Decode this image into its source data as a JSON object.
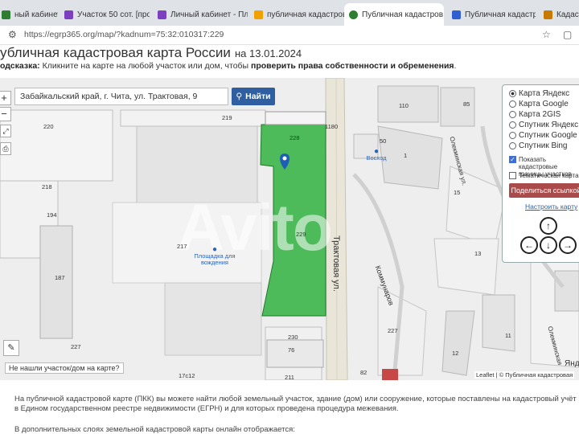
{
  "tabs": [
    {
      "label": "ный кабинет - Оц",
      "color": "#2e7d32"
    },
    {
      "label": "Участок 50 сот. [про",
      "color": "#7b3fbf"
    },
    {
      "label": "Личный кабинет - Пл",
      "color": "#7b3fbf"
    },
    {
      "label": "публичная кадастров",
      "color": "#f0a000"
    },
    {
      "label": "Публичная кадастров",
      "color": "#2e7d32"
    },
    {
      "label": "Публичная кадастров",
      "color": "#2f5fd0"
    },
    {
      "label": "Кадас",
      "color": "#c87a00"
    }
  ],
  "address": {
    "url": "https://egrp365.org/map/?kadnum=75:32:010317:229"
  },
  "heading": {
    "title": "убличная кадастровая карта России",
    "date": "на 13.01.2024"
  },
  "hint": {
    "prefix": "одсказка:",
    "text": " Кликните на карте на любой участок или дом, чтобы ",
    "bold": "проверить права собственности и обременения",
    "suffix": "."
  },
  "search": {
    "value": "Забайкальский край, г. Чита, ул. Трактовая, 9",
    "button": "Найти"
  },
  "map_labels": {
    "l220": "220",
    "l219": "219",
    "l1180": "1180",
    "l228": "228",
    "l110": "110",
    "l85": "85",
    "l50": "50",
    "l1": "1",
    "l218": "218",
    "l194": "194",
    "l187": "187",
    "l217": "217",
    "l227a": "227",
    "l230": "230",
    "l76": "76",
    "l82": "82",
    "l227b": "227",
    "l15": "15",
    "l13": "13",
    "l11": "11",
    "l17c12": "17с12",
    "l211": "211",
    "l229": "229",
    "l12": "12"
  },
  "pois": {
    "vosxod": "Восход",
    "ploshadka": "Площадка для вождения"
  },
  "roads": {
    "traktovaya": "Трактовая ул.",
    "kommunarov": "Коммунаров",
    "oleksinskaya": "Олекминская ул.",
    "oleksinskaya2": "Олекминская"
  },
  "panel": {
    "layers": [
      "Карта Яндекс",
      "Карта Google",
      "Карта 2GIS",
      "Спутник Яндекс",
      "Спутник Google",
      "Спутник Bing"
    ],
    "selected": 0,
    "show_borders": "Показать кадастровые границы участков",
    "thematic": "Тематическая карта",
    "share": "Поделиться ссылкой",
    "setup": "Настроить карту"
  },
  "controls": {
    "zoom_in": "+",
    "zoom_out": "−",
    "not_found": "Не нашли участок/дом на карте?"
  },
  "attribution": {
    "text": "Leaflet | © Публичная кадастровая",
    "extra": "Янд"
  },
  "info": {
    "p1": "На публичной кадастровой карте (ПКК) вы можете найти любой земельный участок, здание (дом) или сооружение, которые поставлены на кадастровый учёт в Едином государственном реестре недвижимости (ЕГРН) и для которых проведена процедура межевания.",
    "p2": "В дополнительных слоях земельной кадастровой карты онлайн отображается:"
  },
  "watermark": "Avito",
  "colors": {
    "parcel": "#3cb54a",
    "button": "#2f5fa0",
    "share": "#a94b4b"
  }
}
